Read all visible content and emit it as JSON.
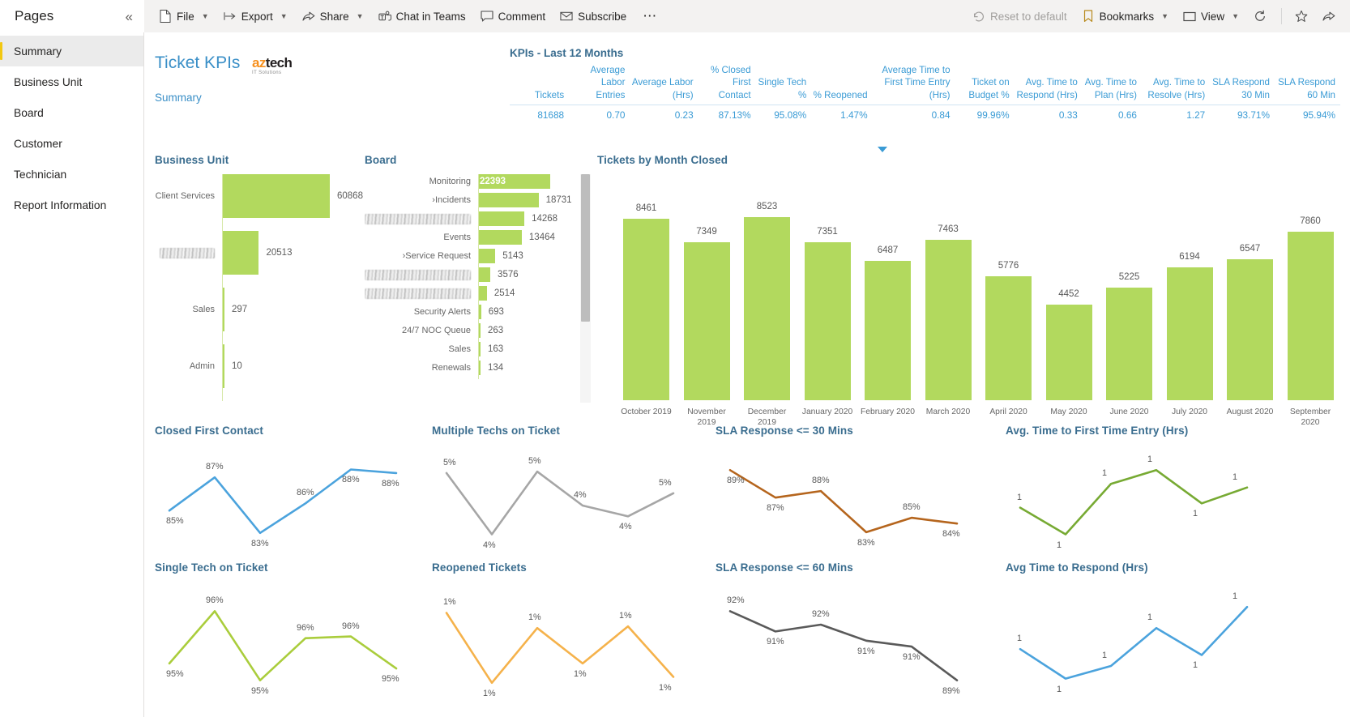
{
  "commandbar": {
    "pages_label": "Pages",
    "collapse_icon": "chevron-double-left-icon",
    "items": [
      {
        "label": "File",
        "icon": "file-icon",
        "caret": true
      },
      {
        "label": "Export",
        "icon": "export-icon",
        "caret": true
      },
      {
        "label": "Share",
        "icon": "share-icon",
        "caret": true
      },
      {
        "label": "Chat in Teams",
        "icon": "teams-icon",
        "caret": false
      },
      {
        "label": "Comment",
        "icon": "comment-icon",
        "caret": false
      },
      {
        "label": "Subscribe",
        "icon": "subscribe-icon",
        "caret": false
      }
    ],
    "more_label": "⋯",
    "right_items": [
      {
        "label": "Reset to default",
        "icon": "reset-icon",
        "caret": false,
        "disabled": true
      },
      {
        "label": "Bookmarks",
        "icon": "bookmark-icon",
        "caret": true,
        "disabled": false
      },
      {
        "label": "View",
        "icon": "view-icon",
        "caret": true,
        "disabled": false
      }
    ],
    "refresh_icon": "refresh-icon",
    "favorite_icon": "star-icon",
    "share_trailing_icon": "share-icon"
  },
  "pages": {
    "items": [
      {
        "label": "Summary",
        "active": true
      },
      {
        "label": "Business Unit",
        "active": false
      },
      {
        "label": "Board",
        "active": false
      },
      {
        "label": "Customer",
        "active": false
      },
      {
        "label": "Technician",
        "active": false
      },
      {
        "label": "Report Information",
        "active": false
      }
    ]
  },
  "report": {
    "title": "Ticket KPIs",
    "subtitle": "Summary",
    "logo_main": "aztech",
    "logo_accent": "az",
    "logo_rest": "tech",
    "logo_sub": "IT Solutions"
  },
  "kpi": {
    "title": "KPIs - Last 12 Months",
    "columns": [
      "Tickets",
      "Average Labor Entries",
      "Average Labor (Hrs)",
      "% Closed First Contact",
      "Single Tech %",
      "% Reopened",
      "Average Time to First Time Entry (Hrs)",
      "Ticket on Budget %",
      "Avg. Time to Respond (Hrs)",
      "Avg. Time to Plan (Hrs)",
      "Avg. Time to Resolve (Hrs)",
      "SLA Respond 30 Min",
      "SLA Respond 60 Min"
    ],
    "values": [
      "81688",
      "0.70",
      "0.23",
      "87.13%",
      "95.08%",
      "1.47%",
      "0.84",
      "99.96%",
      "0.33",
      "0.66",
      "1.27",
      "93.71%",
      "95.94%"
    ]
  },
  "chart_data": [
    {
      "id": "business_unit",
      "type": "bar",
      "title": "Business Unit",
      "orientation": "horizontal",
      "categories": [
        "Client Services",
        "████████",
        "Sales",
        "Admin"
      ],
      "redacted": [
        false,
        true,
        false,
        false
      ],
      "values": [
        60868,
        20513,
        297,
        10
      ],
      "value_labels": [
        "60868",
        "20513",
        "297",
        "10"
      ],
      "color": "#b2d95e",
      "xlabel": "",
      "ylabel": ""
    },
    {
      "id": "board",
      "type": "bar",
      "title": "Board",
      "orientation": "horizontal",
      "categories": [
        "Monitoring",
        "›Incidents",
        "██████████",
        "Events",
        "›Service Request",
        "████████",
        "████████",
        "Security Alerts",
        "24/7 NOC Queue",
        "Sales",
        "Renewals"
      ],
      "redacted": [
        false,
        false,
        true,
        false,
        false,
        true,
        true,
        false,
        false,
        false,
        false
      ],
      "values": [
        22393,
        18731,
        14268,
        13464,
        5143,
        3576,
        2514,
        693,
        263,
        163,
        134
      ],
      "value_labels": [
        "22393",
        "18731",
        "14268",
        "13464",
        "5143",
        "3576",
        "2514",
        "693",
        "263",
        "163",
        "134"
      ],
      "color": "#b2d95e",
      "has_scrollbar": true
    },
    {
      "id": "tickets_by_month_closed",
      "type": "bar",
      "title": "Tickets by Month Closed",
      "orientation": "vertical",
      "categories": [
        "October 2019",
        "November 2019",
        "December 2019",
        "January 2020",
        "February 2020",
        "March 2020",
        "April 2020",
        "May 2020",
        "June 2020",
        "July 2020",
        "August 2020",
        "September 2020"
      ],
      "values": [
        8461,
        7349,
        8523,
        7351,
        6487,
        7463,
        5776,
        4452,
        5225,
        6194,
        6547,
        7860
      ],
      "value_labels": [
        "8461",
        "7349",
        "8523",
        "7351",
        "6487",
        "7463",
        "5776",
        "4452",
        "5225",
        "6194",
        "6547",
        "7860"
      ],
      "color": "#b2d95e",
      "ylim": [
        0,
        8523
      ]
    },
    {
      "id": "closed_first_contact",
      "type": "line",
      "title": "Closed First Contact",
      "color": "#4ba3dd",
      "values": [
        0.85,
        0.87,
        0.83,
        0.86,
        0.88,
        0.88
      ],
      "labels": [
        "85%",
        "87%",
        "83%",
        "86%",
        "88%",
        "88%"
      ],
      "ylim": [
        0.82,
        0.89
      ]
    },
    {
      "id": "multiple_techs_on_ticket",
      "type": "line",
      "title": "Multiple Techs on Ticket",
      "color": "#a6a6a6",
      "values": [
        0.05,
        0.04,
        0.05,
        0.04,
        0.04,
        0.05
      ],
      "labels": [
        "5%",
        "4%",
        "5%",
        "4%",
        "4%",
        "5%"
      ],
      "ylim": [
        0.035,
        0.053
      ]
    },
    {
      "id": "sla_response_30_mins",
      "type": "line",
      "title": "SLA Response <= 30 Mins",
      "color": "#b5651d",
      "values": [
        0.89,
        0.87,
        0.88,
        0.83,
        0.85,
        0.84
      ],
      "labels": [
        "89%",
        "87%",
        "88%",
        "83%",
        "85%",
        "84%"
      ],
      "ylim": [
        0.82,
        0.9
      ]
    },
    {
      "id": "avg_time_first_time_entry",
      "type": "line",
      "title": "Avg. Time to First Time Entry (Hrs)",
      "color": "#77aa33",
      "values": [
        1,
        1,
        1,
        1,
        1,
        1
      ],
      "labels": [
        "1",
        "1",
        "1",
        "1",
        "1",
        "1"
      ],
      "ylim": [
        0,
        2
      ]
    },
    {
      "id": "single_tech_on_ticket",
      "type": "line",
      "title": "Single Tech on Ticket",
      "color": "#aacd3c",
      "values": [
        0.95,
        0.96,
        0.95,
        0.96,
        0.96,
        0.95
      ],
      "labels": [
        "95%",
        "96%",
        "95%",
        "96%",
        "96%",
        "95%"
      ],
      "ylim": [
        0.94,
        0.97
      ]
    },
    {
      "id": "reopened_tickets",
      "type": "line",
      "title": "Reopened Tickets",
      "color": "#f5b24b",
      "values": [
        0.01,
        0.01,
        0.01,
        0.01,
        0.01,
        0.01
      ],
      "labels": [
        "1%",
        "1%",
        "1%",
        "1%",
        "1%",
        "1%"
      ],
      "ylim": [
        0,
        0.02
      ]
    },
    {
      "id": "sla_response_60_mins",
      "type": "line",
      "title": "SLA Response <= 60 Mins",
      "color": "#5a5a5a",
      "values": [
        0.92,
        0.91,
        0.92,
        0.91,
        0.91,
        0.89
      ],
      "labels": [
        "92%",
        "91%",
        "92%",
        "91%",
        "91%",
        "89%"
      ],
      "ylim": [
        0.88,
        0.93
      ]
    },
    {
      "id": "avg_time_to_respond",
      "type": "line",
      "title": "Avg Time to Respond (Hrs)",
      "color": "#4ba3dd",
      "values": [
        1,
        1,
        1,
        1,
        1,
        1
      ],
      "labels": [
        "1",
        "1",
        "1",
        "1",
        "1",
        "1"
      ],
      "ylim": [
        0,
        2
      ]
    }
  ]
}
